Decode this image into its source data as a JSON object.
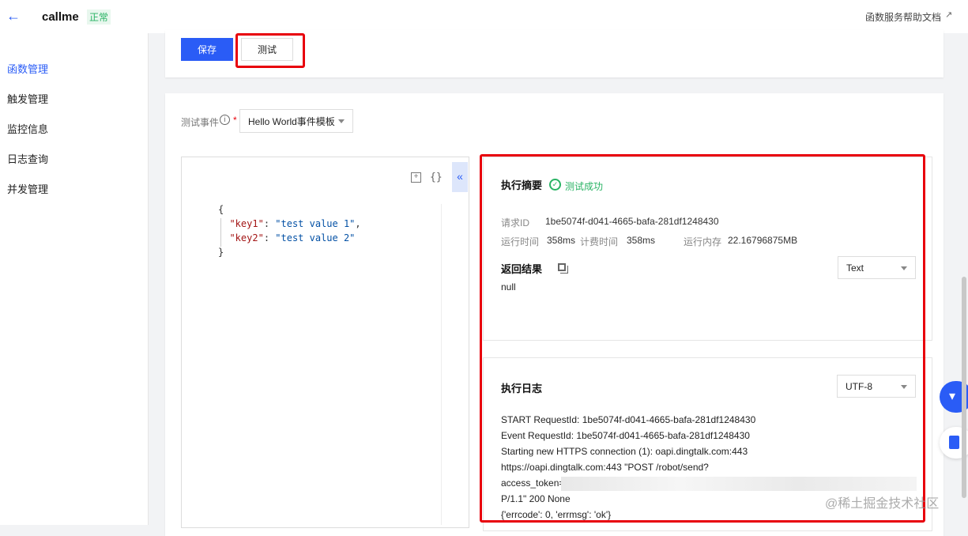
{
  "header": {
    "title": "callme",
    "status": "正常",
    "help_link": "函数服务帮助文档"
  },
  "sidebar": {
    "items": [
      {
        "label": "函数管理",
        "active": true
      },
      {
        "label": "触发管理"
      },
      {
        "label": "监控信息"
      },
      {
        "label": "日志查询"
      },
      {
        "label": "并发管理"
      }
    ]
  },
  "toolbar": {
    "save_label": "保存",
    "test_label": "测试"
  },
  "test_event": {
    "label": "测试事件",
    "selected": "Hello World事件模板"
  },
  "editor": {
    "lines": [
      "{",
      "  \"key1\": \"test value 1\",",
      "  \"key2\": \"test value 2\"",
      "}"
    ]
  },
  "summary": {
    "title": "执行摘要",
    "status": "测试成功",
    "request_id_label": "请求ID",
    "request_id": "1be5074f-d041-4665-bafa-281df1248430",
    "run_time_label": "运行时间",
    "run_time": "358ms",
    "billed_time_label": "计费时间",
    "billed_time": "358ms",
    "memory_label": "运行内存",
    "memory": "22.16796875MB"
  },
  "result": {
    "title": "返回结果",
    "format": "Text",
    "value": "null"
  },
  "log": {
    "title": "执行日志",
    "encoding": "UTF-8",
    "lines": [
      "START RequestId: 1be5074f-d041-4665-bafa-281df1248430",
      "Event RequestId: 1be5074f-d041-4665-bafa-281df1248430",
      "Starting new HTTPS connection (1): oapi.dingtalk.com:443",
      "https://oapi.dingtalk.com:443 \"POST /robot/send?",
      "access_token=",
      "P/1.1\" 200 None",
      "{'errcode': 0, 'errmsg': 'ok'}"
    ]
  },
  "watermark": "@稀土掘金技术社区",
  "colors": {
    "primary": "#2a5cf6",
    "success": "#29b364",
    "highlight": "#e8000b"
  }
}
